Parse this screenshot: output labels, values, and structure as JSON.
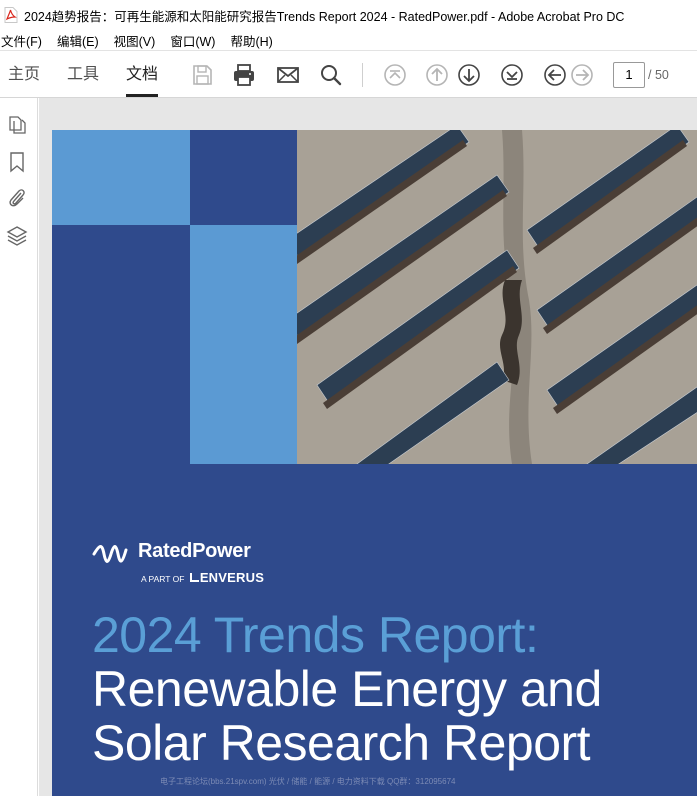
{
  "window": {
    "title": "2024趋势报告：可再生能源和太阳能研究报告Trends Report 2024 - RatedPower.pdf - Adobe Acrobat Pro DC"
  },
  "menu": {
    "items": [
      "文件(F)",
      "编辑(E)",
      "视图(V)",
      "窗口(W)",
      "帮助(H)"
    ]
  },
  "toolbar": {
    "tabs": [
      "主页",
      "工具",
      "文档"
    ],
    "active_tab": "文档",
    "page_current": "1",
    "page_total": "/ 50"
  },
  "document": {
    "brand_name": "RatedPower",
    "brand_sub_small": "A PART OF",
    "brand_sub_big": "ENVERUS",
    "headline_1": "2024 Trends Report:",
    "headline_2": "Renewable Energy and",
    "headline_3": "Solar Research Report",
    "watermark": "电子工程论坛(bbs.21spv.com)        光伏 / 储能 / 能源 / 电力资料下载        QQ群：312095674"
  },
  "colors": {
    "page_bg": "#2f4a8c",
    "light_blue": "#5a9fd6",
    "accent": "#222222"
  }
}
